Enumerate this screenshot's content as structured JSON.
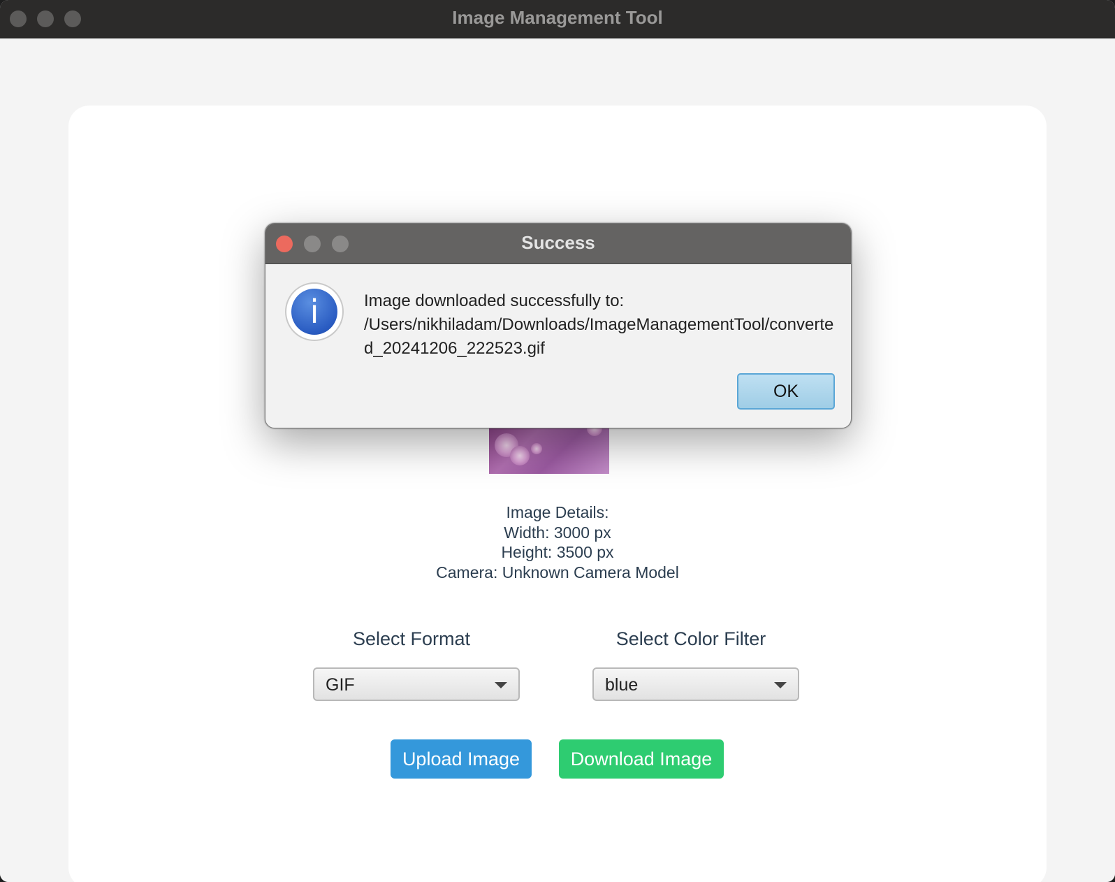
{
  "window": {
    "title": "Image Management Tool"
  },
  "image_details": {
    "heading": "Image Details:",
    "width": "Width: 3000 px",
    "height": "Height: 3500 px",
    "camera": "Camera: Unknown Camera Model"
  },
  "format": {
    "label": "Select Format",
    "value": "GIF"
  },
  "color_filter": {
    "label": "Select Color Filter",
    "value": "blue"
  },
  "buttons": {
    "upload": "Upload Image",
    "download": "Download Image"
  },
  "dialog": {
    "title": "Success",
    "message_line1": "Image downloaded successfully to:",
    "message_path": "/Users/nikhiladam/Downloads/ImageManagementTool/converted_20241206_222523.gif",
    "ok_label": "OK",
    "icon": "info-icon"
  },
  "colors": {
    "upload_button": "#3498db",
    "download_button": "#2ecc71",
    "text": "#2c3e50",
    "close_dot": "#ec6a5e"
  }
}
